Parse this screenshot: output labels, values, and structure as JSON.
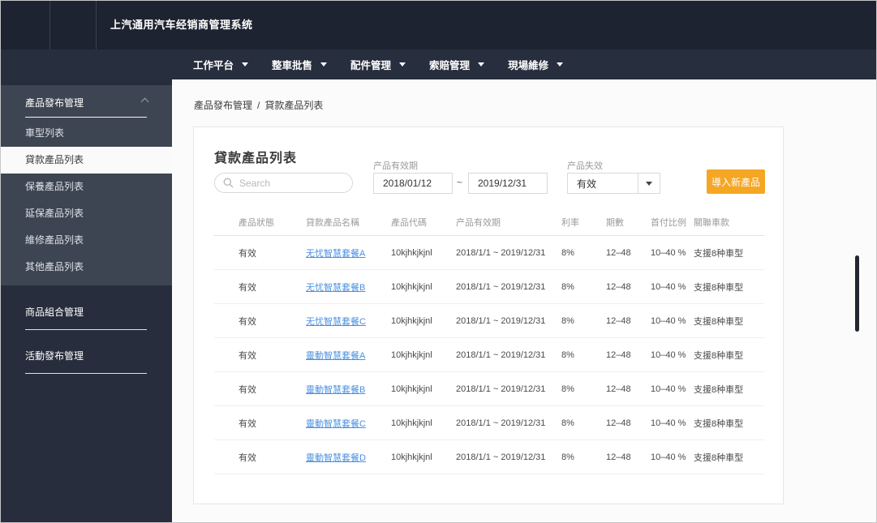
{
  "app": {
    "title": "上汽通用汽车经销商管理系统"
  },
  "nav": {
    "items": [
      {
        "label": "工作平台"
      },
      {
        "label": "整車批售"
      },
      {
        "label": "配件管理"
      },
      {
        "label": "索賠管理"
      },
      {
        "label": "現場維修"
      }
    ]
  },
  "sidebar": {
    "group": {
      "label": "產品發布管理",
      "items": [
        {
          "label": "車型列表"
        },
        {
          "label": "貸款產品列表",
          "selected": true
        },
        {
          "label": "保養產品列表"
        },
        {
          "label": "延保產品列表"
        },
        {
          "label": "維修產品列表"
        },
        {
          "label": "其他產品列表"
        }
      ]
    },
    "links": [
      {
        "label": "商品組合管理"
      },
      {
        "label": "活動發布管理"
      }
    ]
  },
  "breadcrumb": {
    "parent": "產品發布管理",
    "separator": "/",
    "current": "貸款產品列表"
  },
  "panel": {
    "title": "貸款產品列表",
    "search": {
      "placeholder": "Search"
    },
    "filters": {
      "validity_label": "产品有效期",
      "date_from": "2018/01/12",
      "range_separator": "~",
      "date_to": "2019/12/31",
      "status_label": "产品失效",
      "status_value": "有效"
    },
    "import_button": "導入新產品"
  },
  "table": {
    "headers": {
      "status": "產品狀態",
      "name": "貸款產品名稱",
      "code": "產品代碼",
      "validity": "产品有效期",
      "rate": "利率",
      "periods": "期數",
      "down_payment": "首付比例",
      "vehicles": "關聯車款"
    },
    "rows": [
      {
        "status": "有效",
        "name": "无忧智慧套餐A",
        "code": "10kjhkjkjnl",
        "validity": "2018/1/1 ~ 2019/12/31",
        "rate": "8%",
        "periods": "12–48",
        "down_payment": "10–40 %",
        "vehicles": "支援8种車型"
      },
      {
        "status": "有效",
        "name": "无忧智慧套餐B",
        "code": "10kjhkjkjnl",
        "validity": "2018/1/1 ~ 2019/12/31",
        "rate": "8%",
        "periods": "12–48",
        "down_payment": "10–40 %",
        "vehicles": "支援8种車型"
      },
      {
        "status": "有效",
        "name": "无忧智慧套餐C",
        "code": "10kjhkjkjnl",
        "validity": "2018/1/1 ~ 2019/12/31",
        "rate": "8%",
        "periods": "12–48",
        "down_payment": "10–40 %",
        "vehicles": "支援8种車型"
      },
      {
        "status": "有效",
        "name": "靈動智慧套餐A",
        "code": "10kjhkjkjnl",
        "validity": "2018/1/1 ~ 2019/12/31",
        "rate": "8%",
        "periods": "12–48",
        "down_payment": "10–40 %",
        "vehicles": "支援8种車型"
      },
      {
        "status": "有效",
        "name": "靈動智慧套餐B",
        "code": "10kjhkjkjnl",
        "validity": "2018/1/1 ~ 2019/12/31",
        "rate": "8%",
        "periods": "12–48",
        "down_payment": "10–40 %",
        "vehicles": "支援8种車型"
      },
      {
        "status": "有效",
        "name": "靈動智慧套餐C",
        "code": "10kjhkjkjnl",
        "validity": "2018/1/1 ~ 2019/12/31",
        "rate": "8%",
        "periods": "12–48",
        "down_payment": "10–40 %",
        "vehicles": "支援8种車型"
      },
      {
        "status": "有效",
        "name": "靈動智慧套餐D",
        "code": "10kjhkjkjnl",
        "validity": "2018/1/1 ~ 2019/12/31",
        "rate": "8%",
        "periods": "12–48",
        "down_payment": "10–40 %",
        "vehicles": "支援8种車型"
      }
    ]
  },
  "colors": {
    "accent_orange": "#F5A623",
    "link_blue": "#4A90E2"
  }
}
